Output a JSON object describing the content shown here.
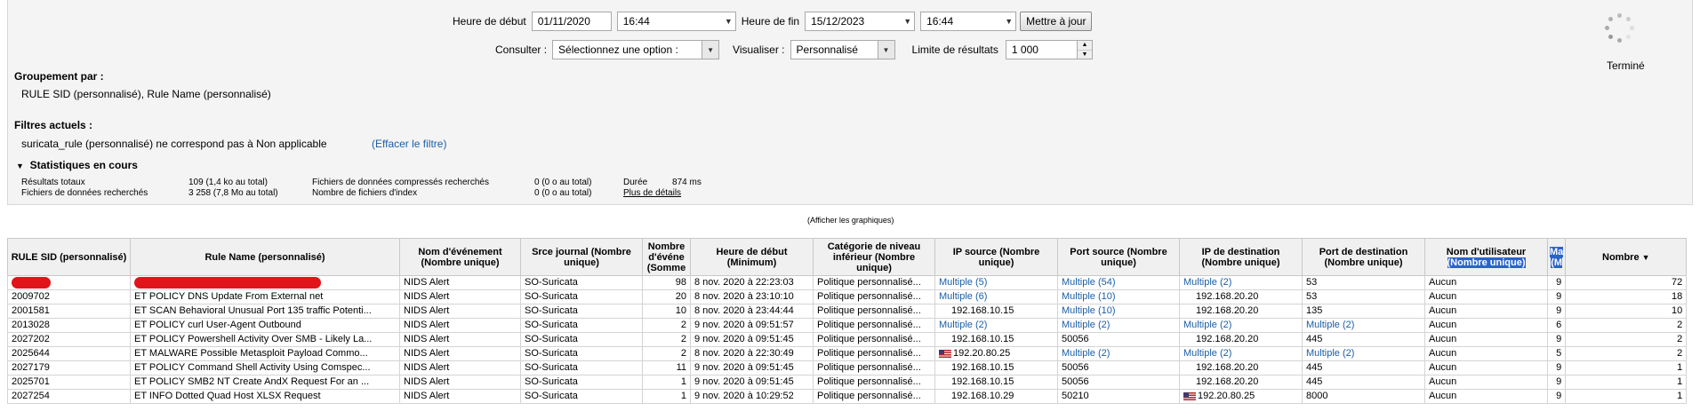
{
  "filters": {
    "start_label": "Heure de début",
    "start_date": "01/11/2020",
    "start_time": "16:44",
    "end_label": "Heure de fin",
    "end_date": "15/12/2023",
    "end_time": "16:44",
    "update_label": "Mettre à jour",
    "consult_label": "Consulter :",
    "consult_value": "Sélectionnez une option :",
    "visualize_label": "Visualiser :",
    "visualize_value": "Personnalisé",
    "limit_label": "Limite de résultats",
    "limit_value": "1 000"
  },
  "status": {
    "done_label": "Terminé"
  },
  "grouping": {
    "title": "Groupement par :",
    "value": "RULE SID (personnalisé), Rule Name (personnalisé)"
  },
  "current_filters": {
    "title": "Filtres actuels :",
    "value": "suricata_rule (personnalisé) ne correspond pas à Non applicable",
    "clear_label": "(Effacer le filtre)"
  },
  "stats": {
    "title": "Statistiques en cours",
    "total_results_label": "Résultats totaux",
    "total_results_value": "109 (1,4 ko au total)",
    "files_searched_label": "Fichiers de données recherchés",
    "files_searched_value": "3 258 (7,8 Mo au total)",
    "compressed_label": "Fichiers de données compressés recherchés",
    "compressed_value": "0 (0 o au total)",
    "index_label": "Nombre de fichiers d'index",
    "index_value": "0 (0 o au total)",
    "duration_label": "Durée",
    "duration_value": "874 ms",
    "more_details": "Plus de détails"
  },
  "show_charts": "(Afficher les graphiques)",
  "table": {
    "headers": {
      "rule_sid": "RULE SID (personnalisé)",
      "rule_name": "Rule Name (personnalisé)",
      "event_name": "Nom d'événement (Nombre unique)",
      "log_source": "Srce journal (Nombre unique)",
      "event_count": "Nombre d'événe (Somme",
      "start_time": "Heure de début (Minimum)",
      "low_category": "Catégorie de niveau inférieur (Nombre unique)",
      "src_ip": "IP source (Nombre unique)",
      "src_port": "Port source (Nombre unique)",
      "dst_ip": "IP de destination (Nombre unique)",
      "dst_port": "Port de destination (Nombre unique)",
      "username": "Nom d'utilisateur",
      "username_sub": "(Nombre unique)",
      "ma": "Ma (M",
      "count": "Nombre"
    },
    "rows": [
      {
        "sid": "",
        "name": "",
        "event": "NIDS Alert",
        "source": "SO-Suricata",
        "events": "98",
        "start": "8 nov. 2020 à 22:23:03",
        "cat": "Politique personnalisé...",
        "srcip": "Multiple (5)",
        "srcport": "Multiple (54)",
        "dstip": "Multiple (2)",
        "dstport": "53",
        "user": "Aucun",
        "ma": "9",
        "count": "72"
      },
      {
        "sid": "2009702",
        "name": "ET POLICY DNS Update From External net",
        "event": "NIDS Alert",
        "source": "SO-Suricata",
        "events": "20",
        "start": "8 nov. 2020 à 23:10:10",
        "cat": "Politique personnalisé...",
        "srcip": "Multiple (6)",
        "srcport": "Multiple (10)",
        "dstip": "192.168.20.20",
        "dstport": "53",
        "user": "Aucun",
        "ma": "9",
        "count": "18"
      },
      {
        "sid": "2001581",
        "name": "ET SCAN Behavioral Unusual Port 135 traffic Potenti...",
        "event": "NIDS Alert",
        "source": "SO-Suricata",
        "events": "10",
        "start": "8 nov. 2020 à 23:44:44",
        "cat": "Politique personnalisé...",
        "srcip": "192.168.10.15",
        "srcport": "Multiple (10)",
        "dstip": "192.168.20.20",
        "dstport": "135",
        "user": "Aucun",
        "ma": "9",
        "count": "10"
      },
      {
        "sid": "2013028",
        "name": "ET POLICY curl User-Agent Outbound",
        "event": "NIDS Alert",
        "source": "SO-Suricata",
        "events": "2",
        "start": "9 nov. 2020 à 09:51:57",
        "cat": "Politique personnalisé...",
        "srcip": "Multiple (2)",
        "srcport": "Multiple (2)",
        "dstip": "Multiple (2)",
        "dstport": "Multiple (2)",
        "user": "Aucun",
        "ma": "6",
        "count": "2"
      },
      {
        "sid": "2027202",
        "name": "ET POLICY Powershell Activity Over SMB - Likely La...",
        "event": "NIDS Alert",
        "source": "SO-Suricata",
        "events": "2",
        "start": "9 nov. 2020 à 09:51:45",
        "cat": "Politique personnalisé...",
        "srcip": "192.168.10.15",
        "srcport": "50056",
        "dstip": "192.168.20.20",
        "dstport": "445",
        "user": "Aucun",
        "ma": "9",
        "count": "2"
      },
      {
        "sid": "2025644",
        "name": "ET MALWARE Possible Metasploit Payload Commo...",
        "event": "NIDS Alert",
        "source": "SO-Suricata",
        "events": "2",
        "start": "8 nov. 2020 à 22:30:49",
        "cat": "Politique personnalisé...",
        "srcip": "192.20.80.25",
        "srcport": "Multiple (2)",
        "dstip": "Multiple (2)",
        "dstport": "Multiple (2)",
        "user": "Aucun",
        "ma": "5",
        "count": "2"
      },
      {
        "sid": "2027179",
        "name": "ET POLICY Command Shell Activity Using Comspec...",
        "event": "NIDS Alert",
        "source": "SO-Suricata",
        "events": "11",
        "start": "9 nov. 2020 à 09:51:45",
        "cat": "Politique personnalisé...",
        "srcip": "192.168.10.15",
        "srcport": "50056",
        "dstip": "192.168.20.20",
        "dstport": "445",
        "user": "Aucun",
        "ma": "9",
        "count": "1"
      },
      {
        "sid": "2025701",
        "name": "ET POLICY SMB2 NT Create AndX Request For an ...",
        "event": "NIDS Alert",
        "source": "SO-Suricata",
        "events": "1",
        "start": "9 nov. 2020 à 09:51:45",
        "cat": "Politique personnalisé...",
        "srcip": "192.168.10.15",
        "srcport": "50056",
        "dstip": "192.168.20.20",
        "dstport": "445",
        "user": "Aucun",
        "ma": "9",
        "count": "1"
      },
      {
        "sid": "2027254",
        "name": "ET INFO Dotted Quad Host XLSX Request",
        "event": "NIDS Alert",
        "source": "SO-Suricata",
        "events": "1",
        "start": "9 nov. 2020 à 10:29:52",
        "cat": "Politique personnalisé...",
        "srcip": "192.168.10.29",
        "srcport": "50210",
        "dstip": "192.20.80.25",
        "dstport": "8000",
        "user": "Aucun",
        "ma": "9",
        "count": "1"
      }
    ]
  },
  "colors": {
    "link": "#1a5fa8",
    "redaction": "#e0141a",
    "highlight": "#2b63c9"
  }
}
